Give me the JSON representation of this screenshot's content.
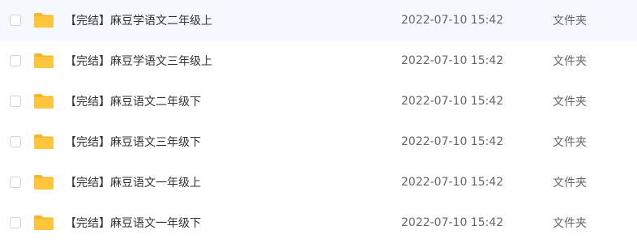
{
  "file_list": {
    "rows": [
      {
        "name": "【完结】麻豆学语文二年级上",
        "modified": "2022-07-10 15:42",
        "type": "文件夹",
        "icon": "folder-icon"
      },
      {
        "name": "【完结】麻豆学语文三年级上",
        "modified": "2022-07-10 15:42",
        "type": "文件夹",
        "icon": "folder-icon"
      },
      {
        "name": "【完结】麻豆语文二年级下",
        "modified": "2022-07-10 15:42",
        "type": "文件夹",
        "icon": "folder-icon"
      },
      {
        "name": "【完结】麻豆语文三年级下",
        "modified": "2022-07-10 15:42",
        "type": "文件夹",
        "icon": "folder-icon"
      },
      {
        "name": "【完结】麻豆语文一年级上",
        "modified": "2022-07-10 15:42",
        "type": "文件夹",
        "icon": "folder-icon"
      },
      {
        "name": "【完结】麻豆语文一年级下",
        "modified": "2022-07-10 15:42",
        "type": "文件夹",
        "icon": "folder-icon"
      }
    ],
    "colors": {
      "folder": "#FFC53D",
      "folder_tab": "#F7B52C",
      "checkbox_border": "#CFD3DC",
      "text_primary": "#333333",
      "text_secondary": "#666666"
    }
  }
}
